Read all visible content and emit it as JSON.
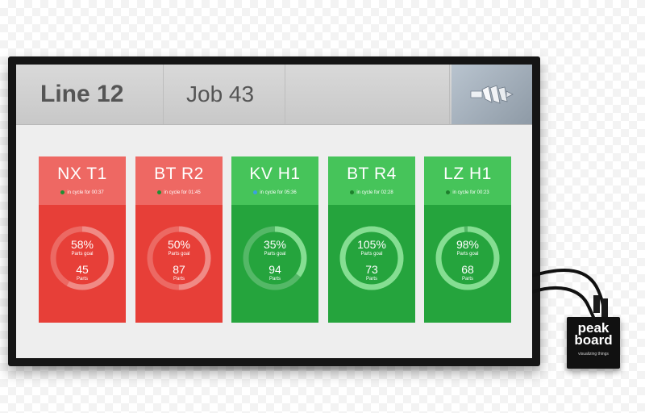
{
  "header": {
    "line_label": "Line 12",
    "job_label": "Job 43"
  },
  "machines": [
    {
      "name": "NX T1",
      "status_color": "#1e8f33",
      "cycle_text": "in cycle for 00:37",
      "percent": "58%",
      "percent_value": 58,
      "goal_label": "Parts goal",
      "parts": "45",
      "parts_label": "Parts",
      "theme": "red"
    },
    {
      "name": "BT R2",
      "status_color": "#1e8f33",
      "cycle_text": "in cycle for 01:45",
      "percent": "50%",
      "percent_value": 50,
      "goal_label": "Parts goal",
      "parts": "87",
      "parts_label": "Parts",
      "theme": "red"
    },
    {
      "name": "KV H1",
      "status_color": "#3aa0e0",
      "cycle_text": "in cycle for 05:36",
      "percent": "35%",
      "percent_value": 35,
      "goal_label": "Parts goal",
      "parts": "94",
      "parts_label": "Parts",
      "theme": "green"
    },
    {
      "name": "BT R4",
      "status_color": "#1e7f2d",
      "cycle_text": "in cycle for 02:28",
      "percent": "105%",
      "percent_value": 105,
      "goal_label": "Parts goal",
      "parts": "73",
      "parts_label": "Parts",
      "theme": "green"
    },
    {
      "name": "LZ H1",
      "status_color": "#1e7f2d",
      "cycle_text": "in cycle for 00:23",
      "percent": "98%",
      "percent_value": 98,
      "goal_label": "Parts goal",
      "parts": "68",
      "parts_label": "Parts",
      "theme": "green"
    }
  ],
  "device": {
    "brand_line1": "peak",
    "brand_line2": "board",
    "tagline": "visualizing things"
  },
  "colors": {
    "red_light": "#ee6863",
    "red_dark": "#e73f38",
    "green_light": "#46c45a",
    "green_dark": "#25a43d"
  }
}
